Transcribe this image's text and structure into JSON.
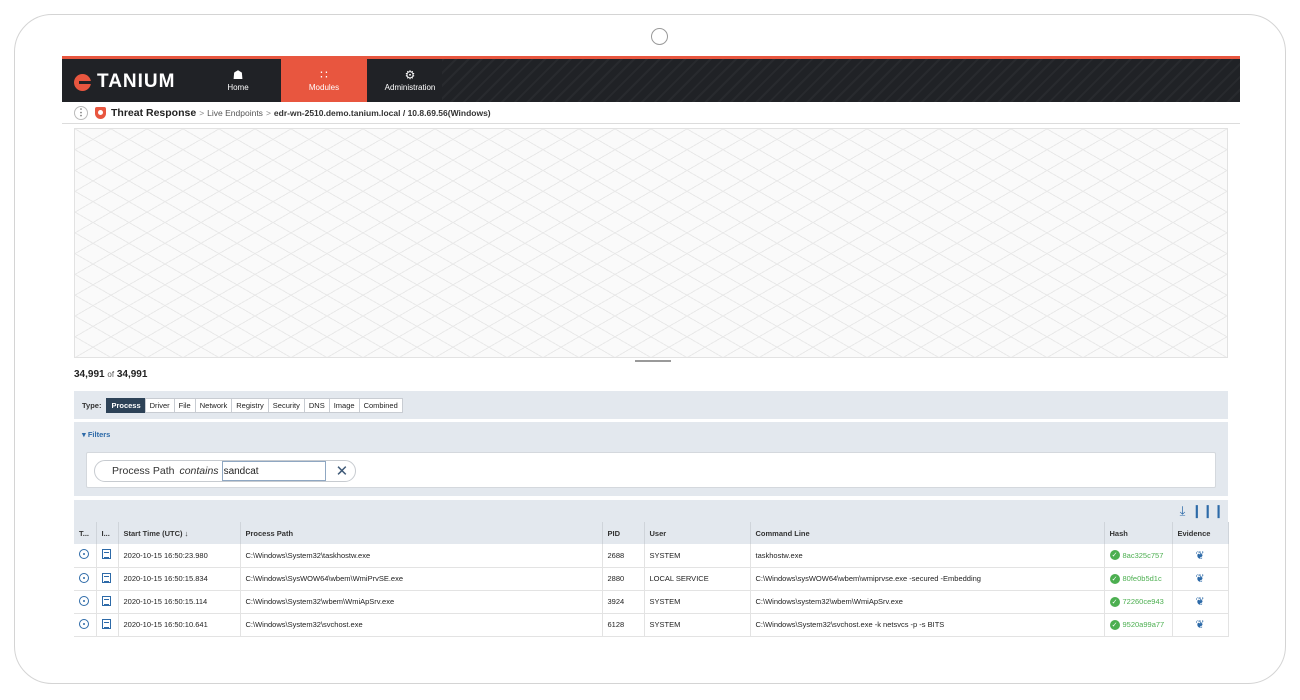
{
  "brand": {
    "name": "TANIUM",
    "accent": "#e8563f",
    "nav_bg": "#202226"
  },
  "nav": [
    {
      "label": "Home",
      "icon": "home-icon"
    },
    {
      "label": "Modules",
      "icon": "grid-icon",
      "active": true
    },
    {
      "label": "Administration",
      "icon": "gear-icon"
    }
  ],
  "breadcrumb": {
    "module": "Threat Response",
    "section": "Live Endpoints",
    "host": "edr-wn-2510.demo.tanium.local / 10.8.69.56(Windows)"
  },
  "count": {
    "shown": "34,991",
    "of": "of",
    "total": "34,991"
  },
  "typebar": {
    "label": "Type:",
    "types": [
      "Process",
      "Driver",
      "File",
      "Network",
      "Registry",
      "Security",
      "DNS",
      "Image",
      "Combined"
    ],
    "active": "Process"
  },
  "filters": {
    "title": "▾ Filters",
    "field": "Process Path",
    "operator": "contains",
    "value": "sandcat"
  },
  "table": {
    "columns": [
      "T...",
      "I...",
      "Start Time (UTC) ↓",
      "Process Path",
      "PID",
      "User",
      "Command Line",
      "Hash",
      "Evidence"
    ],
    "rows": [
      {
        "time": "2020-10-15 16:50:23.980",
        "path": "C:\\Windows\\System32\\taskhostw.exe",
        "pid": "2688",
        "user": "SYSTEM",
        "cmd": "taskhostw.exe",
        "hash": "8ac325c757"
      },
      {
        "time": "2020-10-15 16:50:15.834",
        "path": "C:\\Windows\\SysWOW64\\wbem\\WmiPrvSE.exe",
        "pid": "2880",
        "user": "LOCAL SERVICE",
        "cmd": "C:\\Windows\\sysWOW64\\wbem\\wmiprvse.exe -secured -Embedding",
        "hash": "80fe0b5d1c"
      },
      {
        "time": "2020-10-15 16:50:15.114",
        "path": "C:\\Windows\\System32\\wbem\\WmiApSrv.exe",
        "pid": "3924",
        "user": "SYSTEM",
        "cmd": "C:\\Windows\\system32\\wbem\\WmiApSrv.exe",
        "hash": "72260ce943"
      },
      {
        "time": "2020-10-15 16:50:10.641",
        "path": "C:\\Windows\\System32\\svchost.exe",
        "pid": "6128",
        "user": "SYSTEM",
        "cmd": "C:\\Windows\\System32\\svchost.exe -k netsvcs -p -s BITS",
        "hash": "9520a99a77"
      }
    ]
  }
}
